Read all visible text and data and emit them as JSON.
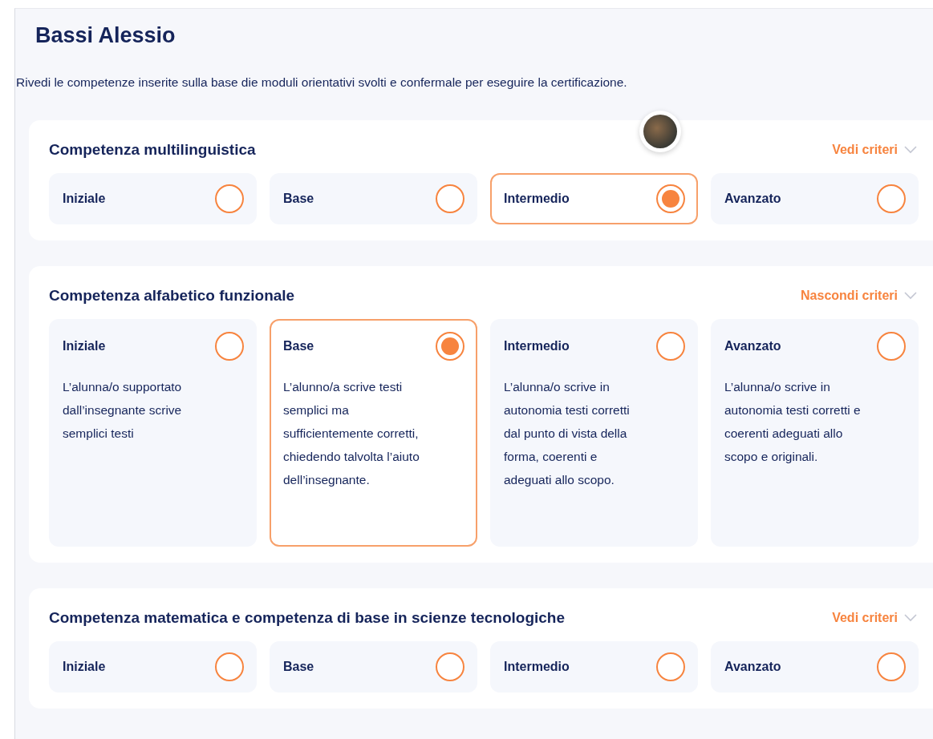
{
  "student": {
    "name": "Bassi Alessio"
  },
  "intro": "Rivedi le competenze inserite sulla base die moduli orientativi svolti e confermale per eseguire la certificazione.",
  "sections": [
    {
      "title": "Competenza multilinguistica",
      "toggle": "Vedi criteri",
      "expanded": false,
      "avatar": true,
      "levels": [
        {
          "label": "Iniziale",
          "selected": false
        },
        {
          "label": "Base",
          "selected": false
        },
        {
          "label": "Intermedio",
          "selected": true
        },
        {
          "label": "Avanzato",
          "selected": false
        }
      ]
    },
    {
      "title": "Competenza alfabetico funzionale",
      "toggle": "Nascondi criteri",
      "expanded": true,
      "avatar": false,
      "levels": [
        {
          "label": "Iniziale",
          "selected": false,
          "description": "L’alunna/o supportato dall’insegnante scrive semplici testi"
        },
        {
          "label": "Base",
          "selected": true,
          "description": "L’alunno/a scrive testi semplici ma sufficientemente corretti, chiedendo talvolta l’aiuto dell’insegnante."
        },
        {
          "label": "Intermedio",
          "selected": false,
          "description": "L’alunna/o scrive in autonomia testi corretti dal punto di vista della forma, coerenti e adeguati allo scopo."
        },
        {
          "label": "Avanzato",
          "selected": false,
          "description": "L’alunna/o scrive in autonomia testi corretti e coerenti adeguati allo scopo e originali."
        }
      ]
    },
    {
      "title": "Competenza matematica e competenza di base in scienze tecnologiche",
      "toggle": "Vedi criteri",
      "expanded": false,
      "avatar": false,
      "levels": [
        {
          "label": "Iniziale",
          "selected": false
        },
        {
          "label": "Base",
          "selected": false
        },
        {
          "label": "Intermedio",
          "selected": false
        },
        {
          "label": "Avanzato",
          "selected": false
        }
      ]
    }
  ]
}
